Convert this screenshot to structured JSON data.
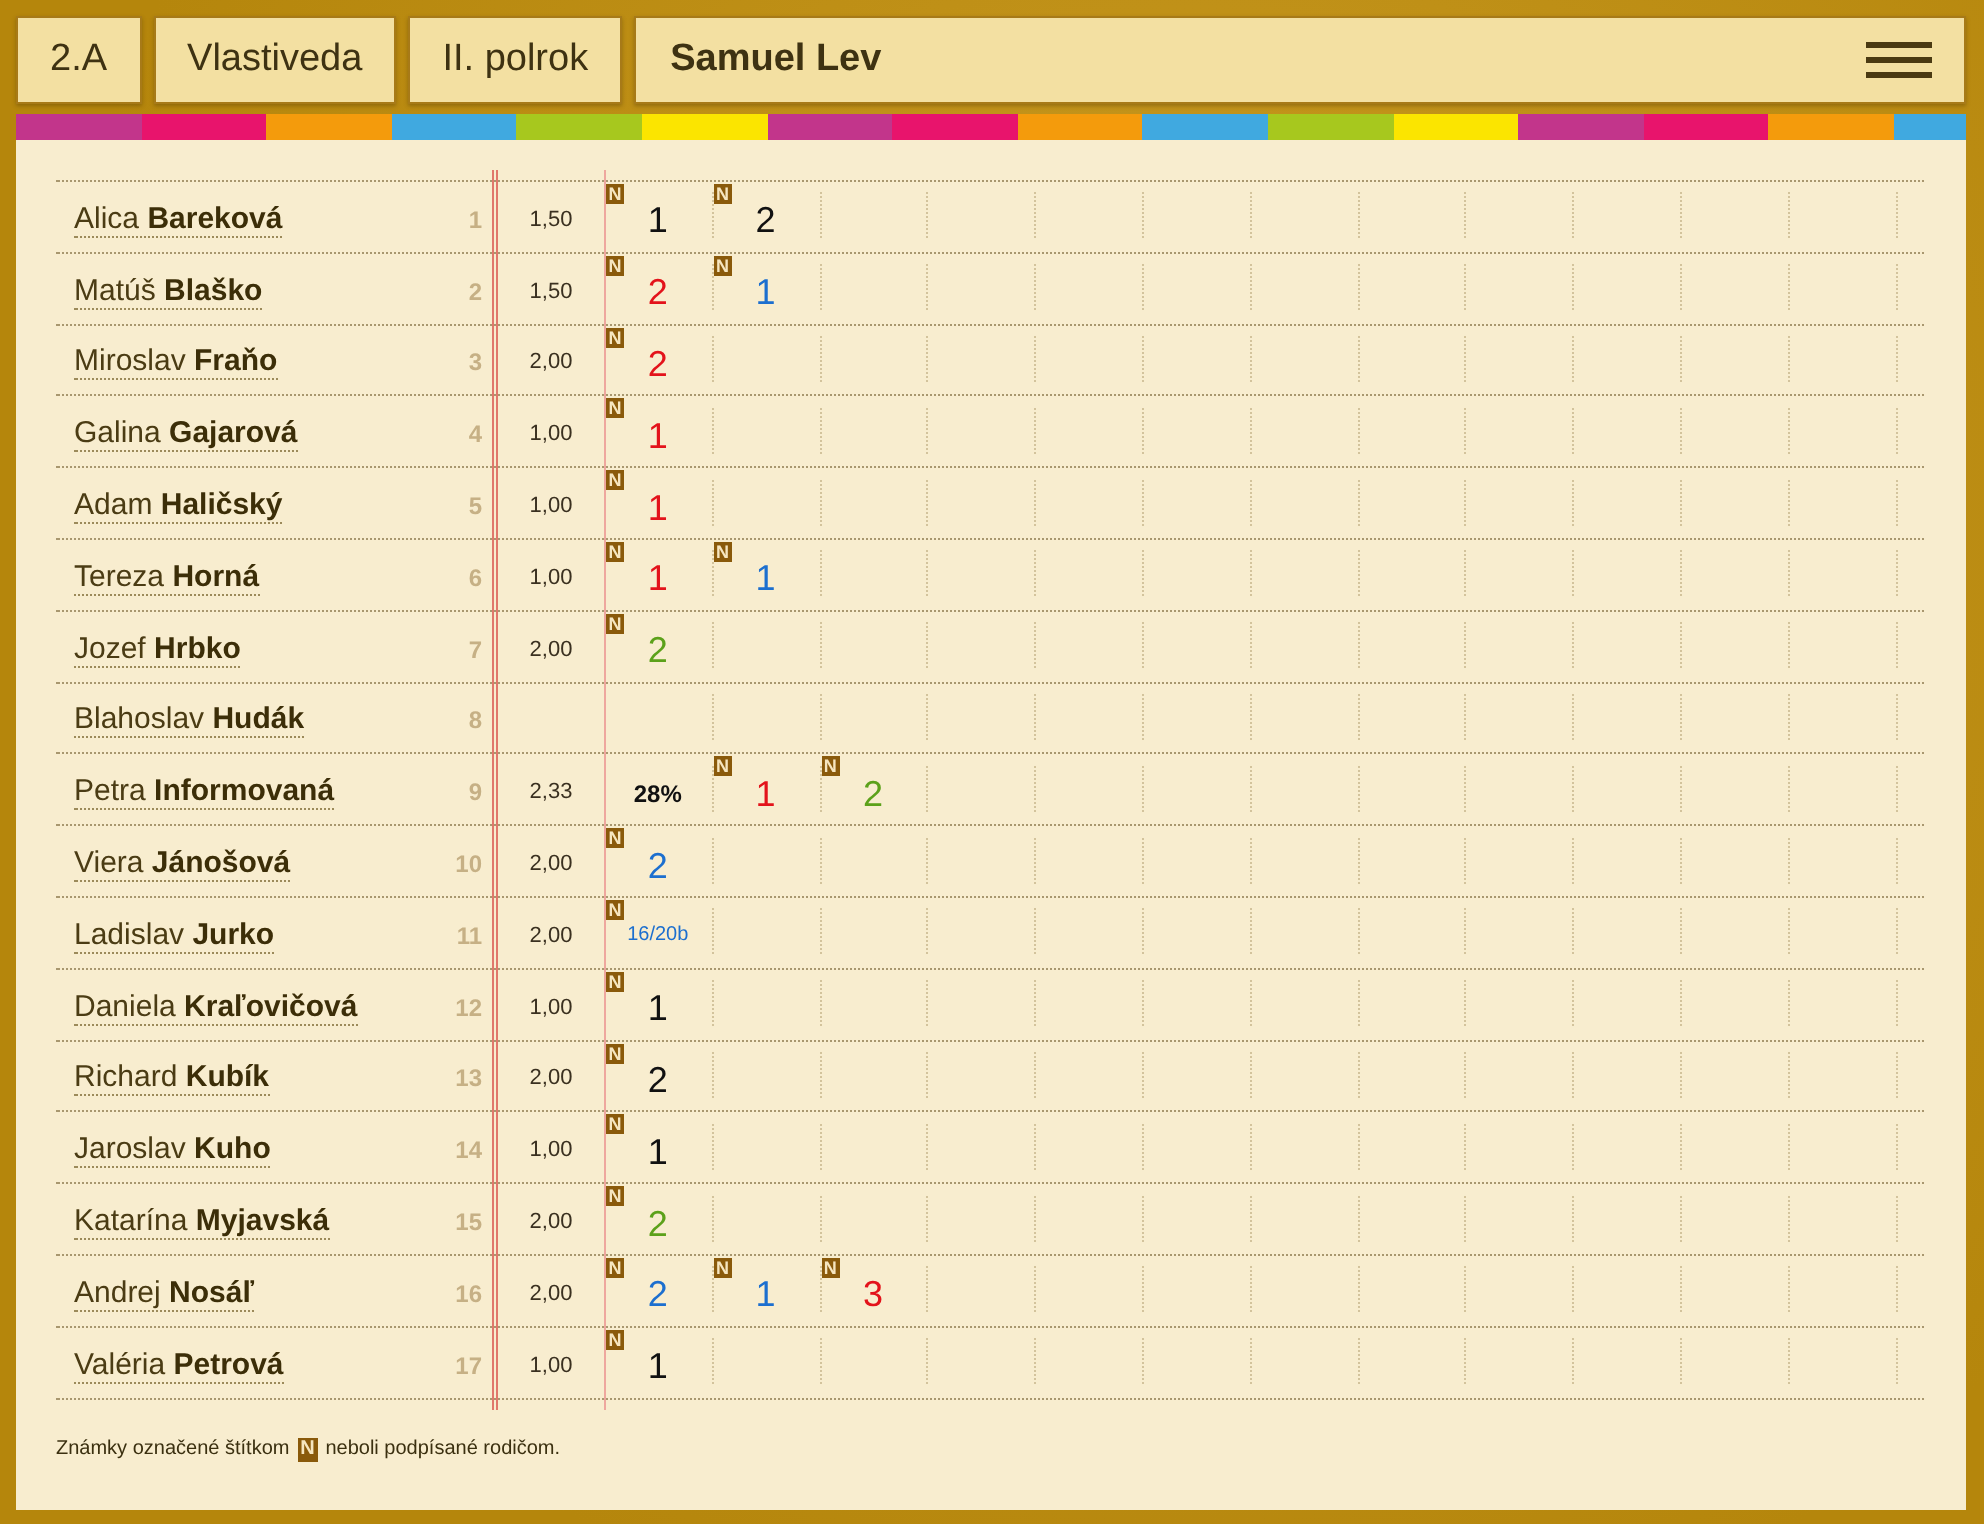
{
  "header": {
    "class_button": "2.A",
    "subject_button": "Vlastiveda",
    "term_button": "II. polrok",
    "user_name": "Samuel Lev"
  },
  "students": [
    {
      "name": "Alica **Bareková**",
      "number": "1",
      "average": "1,50",
      "grades": [
        {
          "kind": "mark",
          "value": "1",
          "color": "#111111",
          "tag": "N"
        },
        {
          "kind": "mark",
          "value": "2",
          "color": "#111111",
          "tag": "N"
        }
      ]
    },
    {
      "name": "Matúš **Blaško**",
      "number": "2",
      "average": "1,50",
      "grades": [
        {
          "kind": "mark",
          "value": "2",
          "color": "#e3131b",
          "tag": "N"
        },
        {
          "kind": "mark",
          "value": "1",
          "color": "#1c6fcf",
          "tag": "N"
        }
      ]
    },
    {
      "name": "Miroslav **Fraňo**",
      "number": "3",
      "average": "2,00",
      "grades": [
        {
          "kind": "mark",
          "value": "2",
          "color": "#e3131b",
          "tag": "N"
        }
      ]
    },
    {
      "name": "Galina **Gajarová**",
      "number": "4",
      "average": "1,00",
      "grades": [
        {
          "kind": "mark",
          "value": "1",
          "color": "#e3131b",
          "tag": "N"
        }
      ]
    },
    {
      "name": "Adam **Haličský**",
      "number": "5",
      "average": "1,00",
      "grades": [
        {
          "kind": "mark",
          "value": "1",
          "color": "#e3131b",
          "tag": "N"
        }
      ]
    },
    {
      "name": "Tereza **Horná**",
      "number": "6",
      "average": "1,00",
      "grades": [
        {
          "kind": "mark",
          "value": "1",
          "color": "#e3131b",
          "tag": "N"
        },
        {
          "kind": "mark",
          "value": "1",
          "color": "#1c6fcf",
          "tag": "N"
        }
      ]
    },
    {
      "name": "Jozef **Hrbko**",
      "number": "7",
      "average": "2,00",
      "grades": [
        {
          "kind": "mark",
          "value": "2",
          "color": "#5ca11a",
          "tag": "N"
        }
      ]
    },
    {
      "name": "Blahoslav **Hudák**",
      "number": "8"
    },
    {
      "name": "Petra **Informovaná**",
      "number": "9",
      "average": "2,33",
      "grades": [
        {
          "kind": "percent",
          "value": "28%",
          "color": "#111111"
        },
        {
          "kind": "mark",
          "value": "1",
          "color": "#e3131b",
          "tag": "N"
        },
        {
          "kind": "mark",
          "value": "2",
          "color": "#5ca11a",
          "tag": "N"
        }
      ]
    },
    {
      "name": "Viera **Jánošová**",
      "number": "10",
      "average": "2,00",
      "grades": [
        {
          "kind": "mark",
          "value": "2",
          "color": "#1c6fcf",
          "tag": "N"
        }
      ]
    },
    {
      "name": "Ladislav **Jurko**",
      "number": "11",
      "average": "2,00",
      "grades": [
        {
          "kind": "points",
          "value": "16/20b",
          "color": "#1c6fcf",
          "tag": "N"
        }
      ]
    },
    {
      "name": "Daniela **Kraľovičová**",
      "number": "12",
      "average": "1,00",
      "grades": [
        {
          "kind": "mark",
          "value": "1",
          "color": "#111111",
          "tag": "N"
        }
      ]
    },
    {
      "name": "Richard **Kubík**",
      "number": "13",
      "average": "2,00",
      "grades": [
        {
          "kind": "mark",
          "value": "2",
          "color": "#111111",
          "tag": "N"
        }
      ]
    },
    {
      "name": "Jaroslav **Kuho**",
      "number": "14",
      "average": "1,00",
      "grades": [
        {
          "kind": "mark",
          "value": "1",
          "color": "#111111",
          "tag": "N"
        }
      ]
    },
    {
      "name": "Katarína **Myjavská**",
      "number": "15",
      "average": "2,00",
      "grades": [
        {
          "kind": "mark",
          "value": "2",
          "color": "#5ca11a",
          "tag": "N"
        }
      ]
    },
    {
      "name": "Andrej **Nosáľ**",
      "number": "16",
      "average": "2,00",
      "grades": [
        {
          "kind": "mark",
          "value": "2",
          "color": "#1c6fcf",
          "tag": "N"
        },
        {
          "kind": "mark",
          "value": "1",
          "color": "#1c6fcf",
          "tag": "N"
        },
        {
          "kind": "mark",
          "value": "3",
          "color": "#e3131b",
          "tag": "N"
        }
      ]
    },
    {
      "name": "Valéria **Petrová**",
      "number": "17",
      "average": "1,00",
      "grades": [
        {
          "kind": "mark",
          "value": "1",
          "color": "#111111",
          "tag": "N"
        }
      ]
    }
  ],
  "legend": {
    "text_before": "Známky označené štítkom",
    "tag": "N",
    "text_after": "neboli podpísané rodičom."
  }
}
